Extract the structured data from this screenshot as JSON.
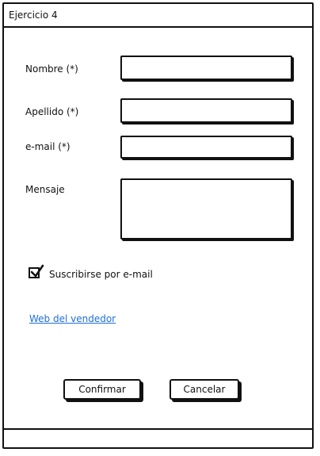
{
  "window": {
    "title": "Ejercicio 4"
  },
  "form": {
    "nombre": {
      "label": "Nombre (*)",
      "value": ""
    },
    "apellido": {
      "label": "Apellido (*)",
      "value": ""
    },
    "email": {
      "label": "e-mail (*)",
      "value": ""
    },
    "mensaje": {
      "label": "Mensaje",
      "value": ""
    },
    "subscribe": {
      "label": "Suscribirse por e-mail",
      "checked": true
    },
    "link": {
      "label": "Web del vendedor"
    }
  },
  "buttons": {
    "confirm": "Confirmar",
    "cancel": "Cancelar"
  },
  "colors": {
    "link": "#1e6fd9",
    "stroke": "#111111"
  }
}
